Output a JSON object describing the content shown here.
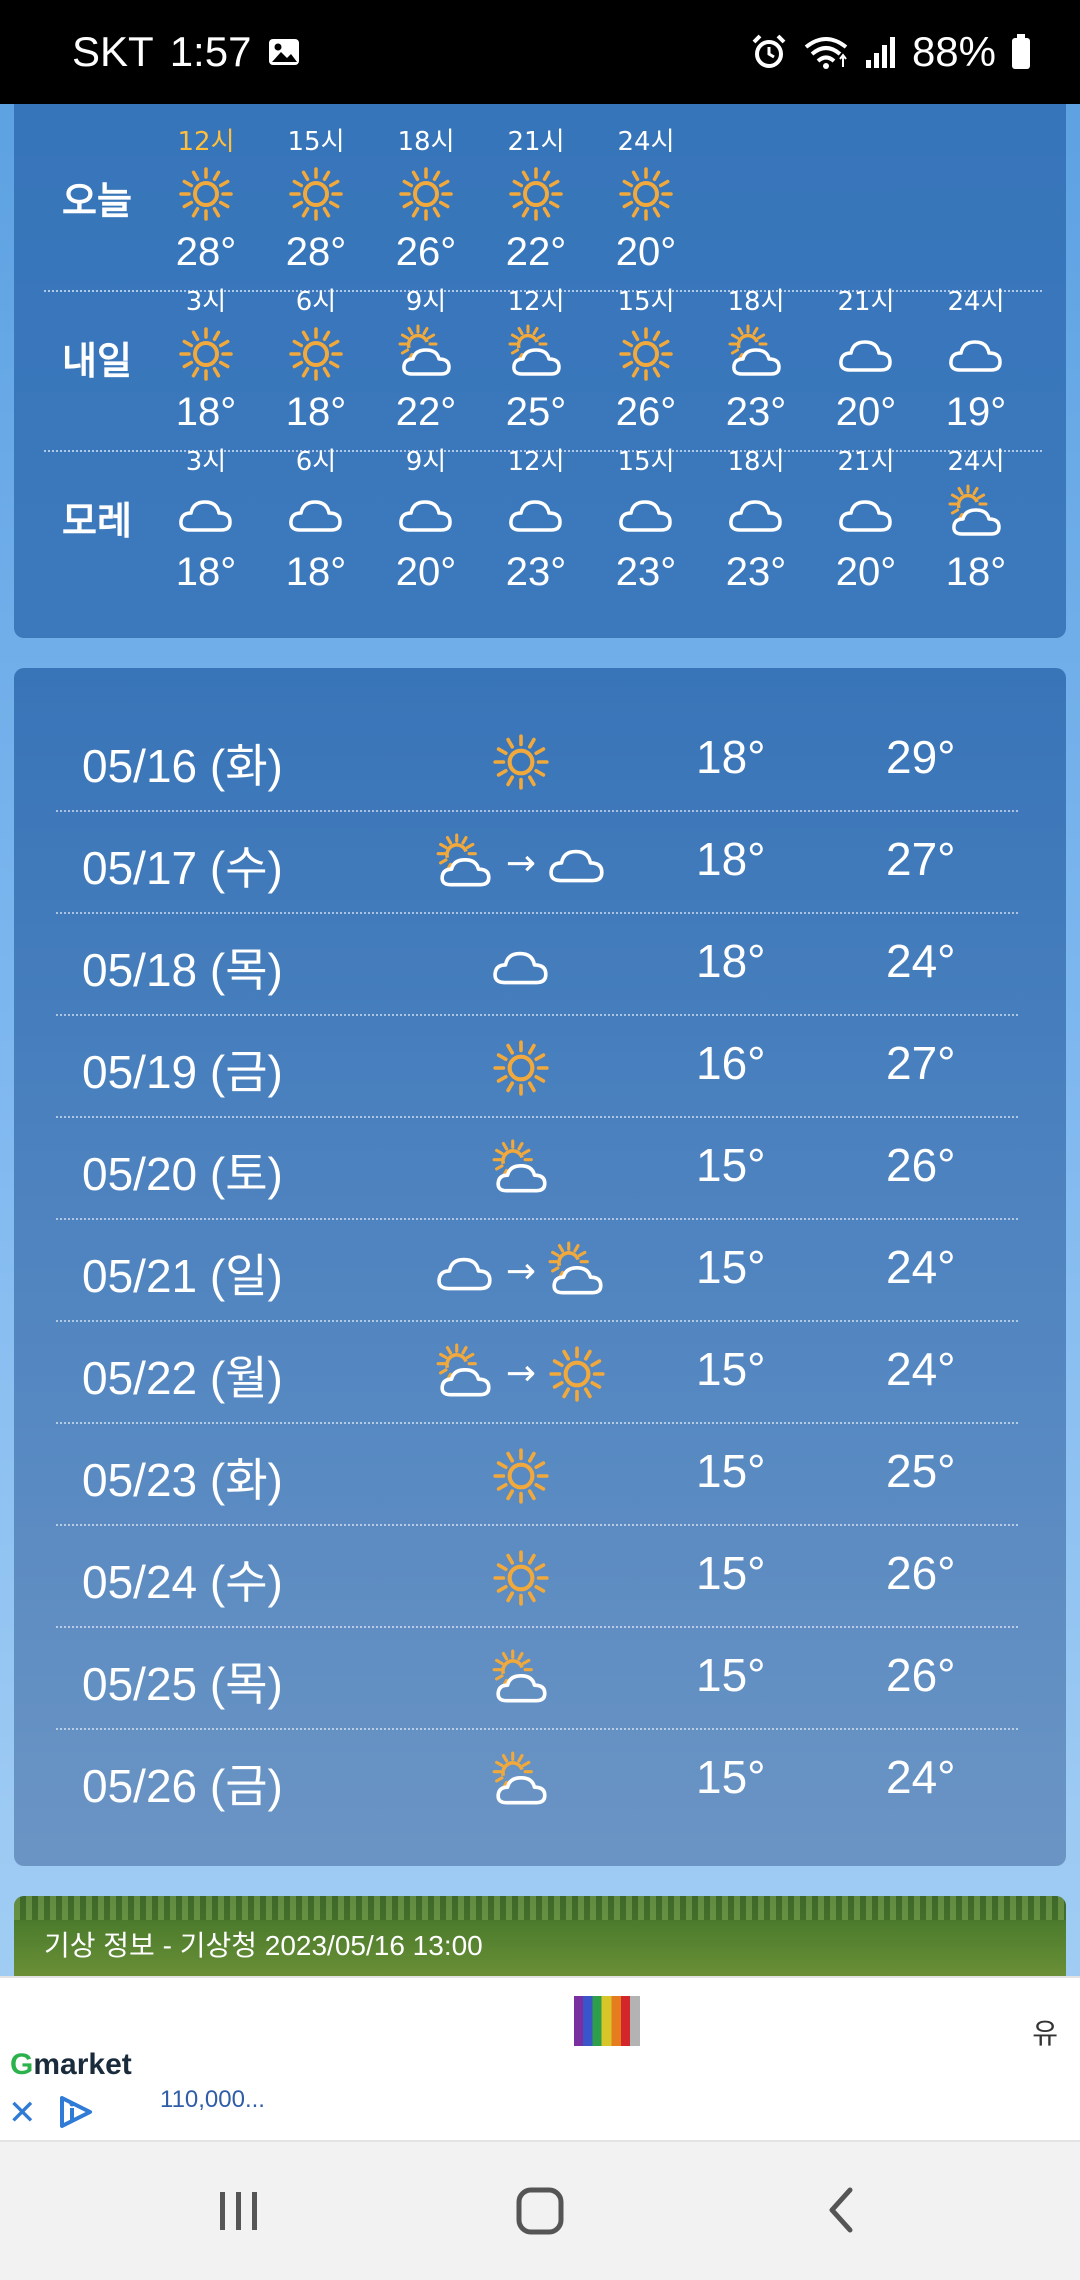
{
  "status_bar": {
    "carrier": "SKT",
    "time": "1:57",
    "battery": "88%",
    "icons": [
      "image-icon",
      "alarm-icon",
      "wifi-icon",
      "signal-icon",
      "battery-icon"
    ]
  },
  "hourly": {
    "rows": [
      {
        "day": "오늘",
        "cols": [
          {
            "hour": "12시",
            "icon": "sun",
            "temp": "28°",
            "current": true
          },
          {
            "hour": "15시",
            "icon": "sun",
            "temp": "28°"
          },
          {
            "hour": "18시",
            "icon": "sun",
            "temp": "26°"
          },
          {
            "hour": "21시",
            "icon": "sun",
            "temp": "22°"
          },
          {
            "hour": "24시",
            "icon": "sun",
            "temp": "20°"
          }
        ]
      },
      {
        "day": "내일",
        "cols": [
          {
            "hour": "3시",
            "icon": "sun",
            "temp": "18°"
          },
          {
            "hour": "6시",
            "icon": "sun",
            "temp": "18°"
          },
          {
            "hour": "9시",
            "icon": "partly",
            "temp": "22°"
          },
          {
            "hour": "12시",
            "icon": "partly",
            "temp": "25°"
          },
          {
            "hour": "15시",
            "icon": "sun",
            "temp": "26°"
          },
          {
            "hour": "18시",
            "icon": "partly",
            "temp": "23°"
          },
          {
            "hour": "21시",
            "icon": "cloud",
            "temp": "20°"
          },
          {
            "hour": "24시",
            "icon": "cloud",
            "temp": "19°"
          }
        ]
      },
      {
        "day": "모레",
        "cols": [
          {
            "hour": "3시",
            "icon": "cloud",
            "temp": "18°"
          },
          {
            "hour": "6시",
            "icon": "cloud",
            "temp": "18°"
          },
          {
            "hour": "9시",
            "icon": "cloud",
            "temp": "20°"
          },
          {
            "hour": "12시",
            "icon": "cloud",
            "temp": "23°"
          },
          {
            "hour": "15시",
            "icon": "cloud",
            "temp": "23°"
          },
          {
            "hour": "18시",
            "icon": "cloud",
            "temp": "23°"
          },
          {
            "hour": "21시",
            "icon": "cloud",
            "temp": "20°"
          },
          {
            "hour": "24시",
            "icon": "partly",
            "temp": "18°"
          }
        ]
      }
    ]
  },
  "daily": {
    "rows": [
      {
        "date": "05/16 (화)",
        "icons": [
          "sun"
        ],
        "min": "18°",
        "max": "29°"
      },
      {
        "date": "05/17 (수)",
        "icons": [
          "partly",
          "cloud"
        ],
        "min": "18°",
        "max": "27°"
      },
      {
        "date": "05/18 (목)",
        "icons": [
          "cloud"
        ],
        "min": "18°",
        "max": "24°"
      },
      {
        "date": "05/19 (금)",
        "icons": [
          "sun"
        ],
        "min": "16°",
        "max": "27°"
      },
      {
        "date": "05/20 (토)",
        "icons": [
          "partly"
        ],
        "min": "15°",
        "max": "26°"
      },
      {
        "date": "05/21 (일)",
        "icons": [
          "cloud",
          "partly"
        ],
        "min": "15°",
        "max": "24°"
      },
      {
        "date": "05/22 (월)",
        "icons": [
          "partly",
          "sun"
        ],
        "min": "15°",
        "max": "24°"
      },
      {
        "date": "05/23 (화)",
        "icons": [
          "sun"
        ],
        "min": "15°",
        "max": "25°"
      },
      {
        "date": "05/24 (수)",
        "icons": [
          "sun"
        ],
        "min": "15°",
        "max": "26°"
      },
      {
        "date": "05/25 (목)",
        "icons": [
          "partly"
        ],
        "min": "15°",
        "max": "26°"
      },
      {
        "date": "05/26 (금)",
        "icons": [
          "partly"
        ],
        "min": "15°",
        "max": "24°"
      }
    ],
    "arrow": "→"
  },
  "info": {
    "line1": "기상 정보 - 기상청 2023/05/16 13:00"
  },
  "ad": {
    "brand_g": "G",
    "brand_rest": "market",
    "price": "110,000...",
    "right_text": "유",
    "close": "✕"
  },
  "colors": {
    "sun": "#f2a93b",
    "current_hour": "#ffbf3a",
    "panel": "#2864aa"
  }
}
